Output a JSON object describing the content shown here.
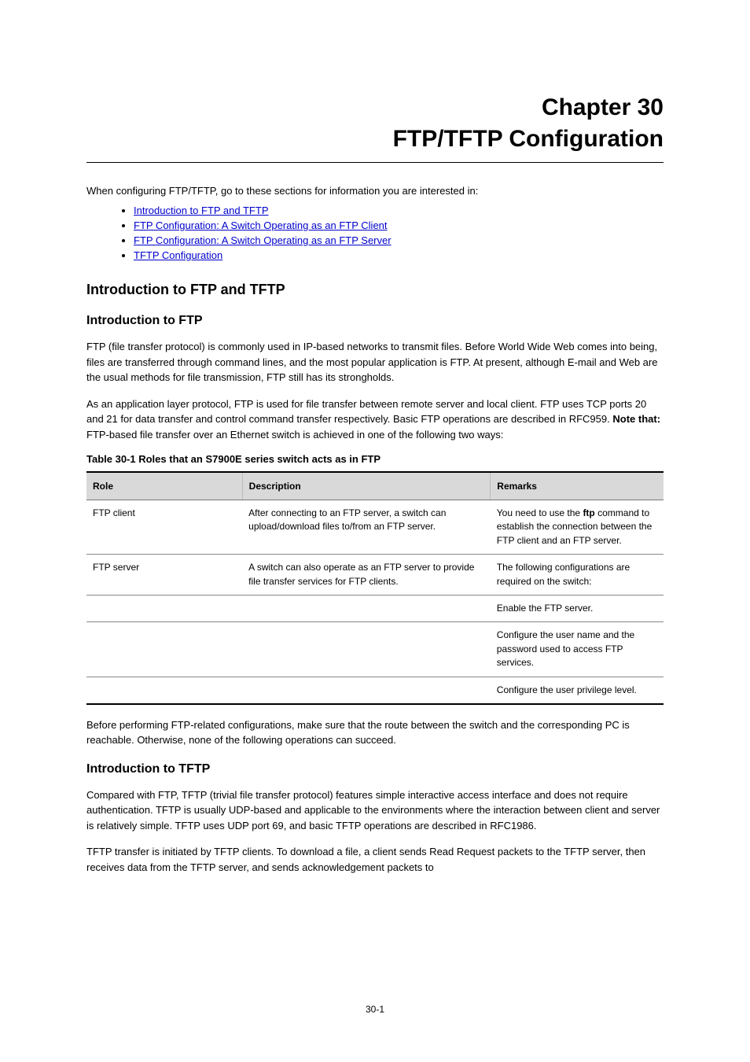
{
  "chapter": {
    "label": "Chapter 30",
    "title": "FTP/TFTP Configuration"
  },
  "intro": "When configuring FTP/TFTP, go to these sections for information you are interested in:",
  "toc": [
    {
      "text": "Introduction to FTP and TFTP"
    },
    {
      "text": "FTP Configuration: A Switch Operating as an FTP Client"
    },
    {
      "text": "FTP Configuration: A Switch Operating as an FTP Server"
    },
    {
      "text": "TFTP Configuration"
    }
  ],
  "section": {
    "title": "Introduction to FTP and TFTP",
    "subhead_ftp": "Introduction to FTP",
    "para1": "FTP (file transfer protocol) is commonly used in IP-based networks to transmit files. Before World Wide Web comes into being, files are transferred through command lines, and the most popular application is FTP. At present, although E-mail and Web are the usual methods for file transmission, FTP still has its strongholds.",
    "para2_1": "As an application layer protocol, FTP is used for file transfer between remote server and local client. FTP uses TCP ports 20 and 21 for data transfer and control command transfer respectively. Basic FTP operations are described in RFC959.",
    "para2_2": "FTP-based file transfer over an Ethernet switch is achieved in one of the following two ways:",
    "note_label": "Note that:"
  },
  "table": {
    "caption": "Table 30-1 Roles that an S7900E series switch acts as in FTP",
    "headers": [
      "Role",
      "Description",
      "Remarks"
    ],
    "rows": [
      {
        "role": "FTP client",
        "desc": "After connecting to an FTP server, a switch can upload/download files to/from an FTP server.",
        "remarks_parts": [
          "You need to use the ",
          "ftp",
          " command to establish the connection between the FTP client and an FTP server."
        ],
        "bold_idx": 1
      },
      {
        "role": "FTP server",
        "desc": "A switch can also operate as an FTP server to provide file transfer services for FTP clients.",
        "remarks_parts": [
          "The following configurations are required on the switch:"
        ]
      },
      {
        "role": "",
        "desc": "",
        "remarks_parts": [
          "Enable the FTP server."
        ]
      },
      {
        "role": "",
        "desc": "",
        "remarks_parts": [
          "Configure the user name and the password used to access FTP services."
        ]
      },
      {
        "role": "",
        "desc": "",
        "remarks_parts": [
          "Configure the user privilege level."
        ]
      }
    ]
  },
  "body2": {
    "para1": "Before performing FTP-related configurations, make sure that the route between the switch and the corresponding PC is reachable. Otherwise, none of the following operations can succeed.",
    "subhead_tftp": "Introduction to TFTP",
    "para2": "Compared with FTP, TFTP (trivial file transfer protocol) features simple interactive access interface and does not require authentication. TFTP is usually UDP-based and applicable to the environments where the interaction between client and server is relatively simple. TFTP uses UDP port 69, and basic TFTP operations are described in RFC1986.",
    "para3": "TFTP transfer is initiated by TFTP clients. To download a file, a client sends Read Request packets to the TFTP server, then receives data from the TFTP server, and sends acknowledgement packets to"
  },
  "footer": "30-1"
}
